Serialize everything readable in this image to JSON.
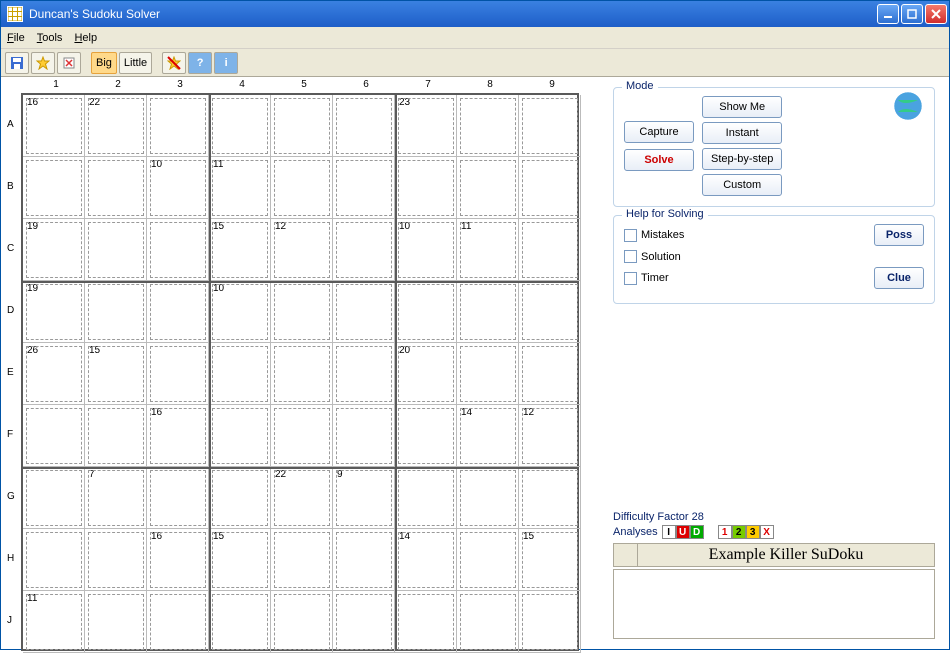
{
  "window": {
    "title": "Duncan's Sudoku Solver"
  },
  "menu": {
    "file": "File",
    "tools": "Tools",
    "help": "Help"
  },
  "toolbar": {
    "big": "Big",
    "little": "Little",
    "question": "?",
    "info": "i"
  },
  "grid": {
    "cols": [
      "1",
      "2",
      "3",
      "4",
      "5",
      "6",
      "7",
      "8",
      "9"
    ],
    "rows": [
      "A",
      "B",
      "C",
      "D",
      "E",
      "F",
      "G",
      "H",
      "J"
    ],
    "cages": [
      {
        "r": 0,
        "c": 0,
        "sum": "16"
      },
      {
        "r": 0,
        "c": 1,
        "sum": "22"
      },
      {
        "r": 0,
        "c": 6,
        "sum": "23"
      },
      {
        "r": 1,
        "c": 2,
        "sum": "10"
      },
      {
        "r": 1,
        "c": 3,
        "sum": "11"
      },
      {
        "r": 2,
        "c": 0,
        "sum": "19"
      },
      {
        "r": 2,
        "c": 3,
        "sum": "15"
      },
      {
        "r": 2,
        "c": 4,
        "sum": "12"
      },
      {
        "r": 2,
        "c": 6,
        "sum": "10"
      },
      {
        "r": 2,
        "c": 7,
        "sum": "11"
      },
      {
        "r": 3,
        "c": 0,
        "sum": "19"
      },
      {
        "r": 3,
        "c": 3,
        "sum": "10"
      },
      {
        "r": 4,
        "c": 0,
        "sum": "26"
      },
      {
        "r": 4,
        "c": 1,
        "sum": "15"
      },
      {
        "r": 4,
        "c": 6,
        "sum": "20"
      },
      {
        "r": 5,
        "c": 2,
        "sum": "16"
      },
      {
        "r": 5,
        "c": 7,
        "sum": "14"
      },
      {
        "r": 5,
        "c": 8,
        "sum": "12"
      },
      {
        "r": 6,
        "c": 1,
        "sum": "7"
      },
      {
        "r": 6,
        "c": 4,
        "sum": "22"
      },
      {
        "r": 6,
        "c": 5,
        "sum": "9"
      },
      {
        "r": 7,
        "c": 2,
        "sum": "16"
      },
      {
        "r": 7,
        "c": 3,
        "sum": "15"
      },
      {
        "r": 7,
        "c": 6,
        "sum": "14"
      },
      {
        "r": 7,
        "c": 8,
        "sum": "15"
      },
      {
        "r": 8,
        "c": 0,
        "sum": "11"
      }
    ]
  },
  "mode": {
    "legend": "Mode",
    "capture": "Capture",
    "solve": "Solve",
    "showme": "Show Me",
    "instant": "Instant",
    "stepbystep": "Step-by-step",
    "custom": "Custom"
  },
  "help": {
    "legend": "Help for Solving",
    "mistakes": "Mistakes",
    "solution": "Solution",
    "timer": "Timer",
    "poss": "Poss",
    "clue": "Clue"
  },
  "status": {
    "difficulty": "Difficulty Factor 28",
    "analyses_label": "Analyses",
    "analyses": [
      {
        "ch": "I",
        "bg": "#fff",
        "fg": "#000"
      },
      {
        "ch": "U",
        "bg": "#d00",
        "fg": "#fff"
      },
      {
        "ch": "D",
        "bg": "#0a0",
        "fg": "#fff"
      },
      {
        "ch": "1",
        "bg": "#fff",
        "fg": "#d00"
      },
      {
        "ch": "2",
        "bg": "#7c0",
        "fg": "#000"
      },
      {
        "ch": "3",
        "bg": "#fc0",
        "fg": "#000"
      },
      {
        "ch": "X",
        "bg": "#fff",
        "fg": "#d00"
      }
    ],
    "puzzle_title": "Example Killer SuDoku"
  }
}
